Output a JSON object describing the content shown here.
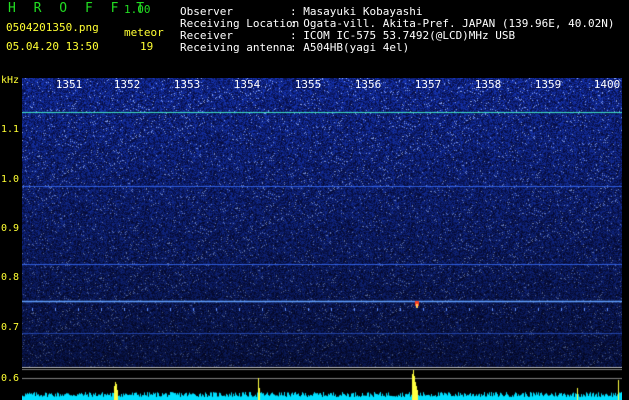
{
  "header": {
    "app_title": "H R O F F T",
    "version": "1.00",
    "filename": "0504201350.png",
    "datetime": "05.04.20 13:50",
    "meteor_label": "meteor",
    "meteor_count": "19"
  },
  "info": {
    "observer_label": "Observer",
    "observer_value": ": Masayuki Kobayashi",
    "location_label": "Receiving Location",
    "location_value": ": Ogata-vill. Akita-Pref. JAPAN (139.96E, 40.02N)",
    "receiver_label": "Receiver",
    "receiver_value": ": ICOM IC-575 53.7492(@LCD)MHz USB",
    "antenna_label": "Receiving antenna",
    "antenna_value": ": A504HB(yagi 4el)"
  },
  "axis": {
    "y_unit": "kHz",
    "y_ticks": [
      "1.1",
      "1.0",
      "0.9",
      "0.8",
      "0.7",
      "0.6"
    ],
    "x_ticks": [
      "1351",
      "1352",
      "1353",
      "1354",
      "1355",
      "1356",
      "1357",
      "1358",
      "1359",
      "1400"
    ]
  },
  "colors": {
    "background": "#000000",
    "spectrogram_base": "#0a1a80",
    "signal_line": "#40c0ff",
    "meteor": "#ff4020",
    "trace": "#00e0ff",
    "burst": "#ffff40"
  }
}
